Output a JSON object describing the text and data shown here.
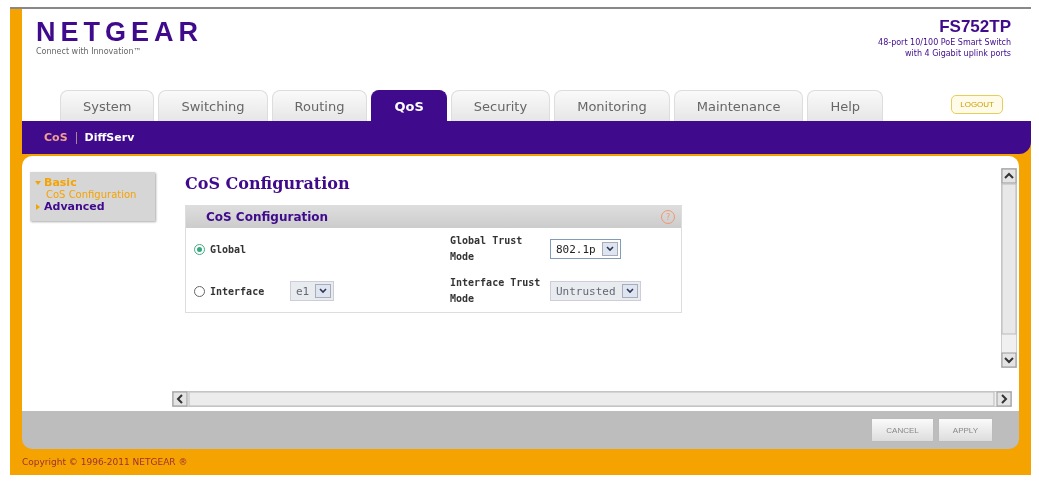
{
  "header": {
    "logo": "NETGEAR",
    "tagline": "Connect with Innovation™",
    "model": "FS752TP",
    "description_lines": [
      "48-port 10/100 PoE Smart Switch",
      "with 4 Gigabit uplink ports"
    ]
  },
  "tabs": [
    {
      "label": "System",
      "selected": false
    },
    {
      "label": "Switching",
      "selected": false
    },
    {
      "label": "Routing",
      "selected": false
    },
    {
      "label": "QoS",
      "selected": true
    },
    {
      "label": "Security",
      "selected": false
    },
    {
      "label": "Monitoring",
      "selected": false
    },
    {
      "label": "Maintenance",
      "selected": false
    },
    {
      "label": "Help",
      "selected": false
    }
  ],
  "logout_button": "LOGOUT",
  "subnav": [
    {
      "label": "CoS",
      "selected": true
    },
    {
      "label": "DiffServ",
      "selected": false
    }
  ],
  "sidebar": {
    "items": [
      {
        "label": "Basic",
        "expanded": true,
        "children": [
          {
            "label": "CoS Configuration",
            "selected": true
          }
        ]
      },
      {
        "label": "Advanced",
        "expanded": false
      }
    ]
  },
  "page_title": "CoS Configuration",
  "panel": {
    "title": "CoS Configuration",
    "help": "?",
    "rows": [
      {
        "radio_label": "Global",
        "selected": true,
        "mode_label": "Global Trust Mode",
        "mode_value": "802.1p",
        "mode_disabled": false
      },
      {
        "radio_label": "Interface",
        "selected": false,
        "port_value": "e1",
        "port_disabled": true,
        "mode_label": "Interface Trust Mode",
        "mode_value": "Untrusted",
        "mode_disabled": true
      }
    ]
  },
  "buttons": [
    "CANCEL",
    "APPLY"
  ],
  "footer": "Copyright © 1996-2011 NETGEAR ®"
}
